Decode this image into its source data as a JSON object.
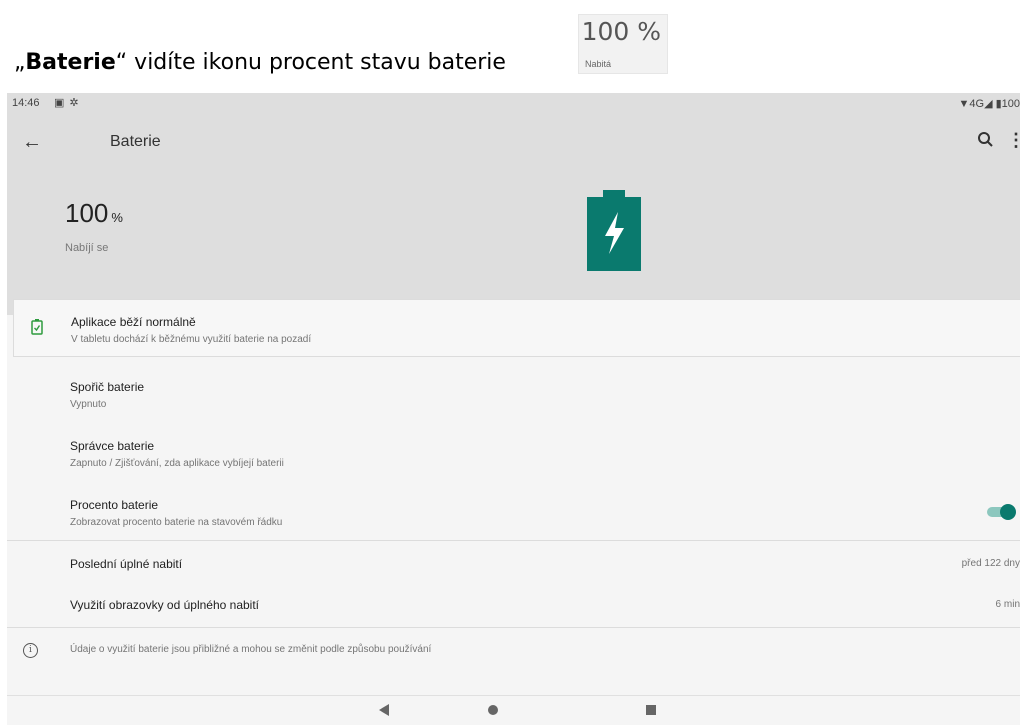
{
  "caption": {
    "prefix": "„",
    "bold": "Baterie",
    "rest": "“ vidíte ikonu procent stavu baterie",
    "badge_percent": "100 %",
    "badge_label": "Nabitá"
  },
  "status_bar": {
    "time": "14:46",
    "right": "▼4G◢ ▮100"
  },
  "app_bar": {
    "back_icon": "←",
    "title": "Baterie",
    "more_icon": "⋮"
  },
  "battery": {
    "percent": "100",
    "unit": "%",
    "state": "Nabíjí se",
    "level": 1.0,
    "icon_color": "#0a7a6e"
  },
  "status_card": {
    "title": "Aplikace běží normálně",
    "subtitle": "V tabletu dochází k běžnému využití baterie na pozadí"
  },
  "settings": [
    {
      "title": "Spořič baterie",
      "subtitle": "Vypnuto"
    },
    {
      "title": "Správce baterie",
      "subtitle": "Zapnuto / Zjišťování, zda aplikace vybíjejí baterii"
    },
    {
      "title": "Procento baterie",
      "subtitle": "Zobrazovat procento baterie na stavovém řádku",
      "toggle_on": true
    }
  ],
  "usage": [
    {
      "title": "Poslední úplné nabití",
      "value": "před 122 dny"
    },
    {
      "title": "Využití obrazovky od úplného nabití",
      "value": "6 min"
    }
  ],
  "footer_note": {
    "icon": "i",
    "text": "Údaje o využití baterie jsou přibližné a mohou se změnit podle způsobu používání"
  },
  "colors": {
    "accent": "#0a7a6e",
    "header_bg": "#dedede",
    "card_icon": "#2e9b3e"
  }
}
